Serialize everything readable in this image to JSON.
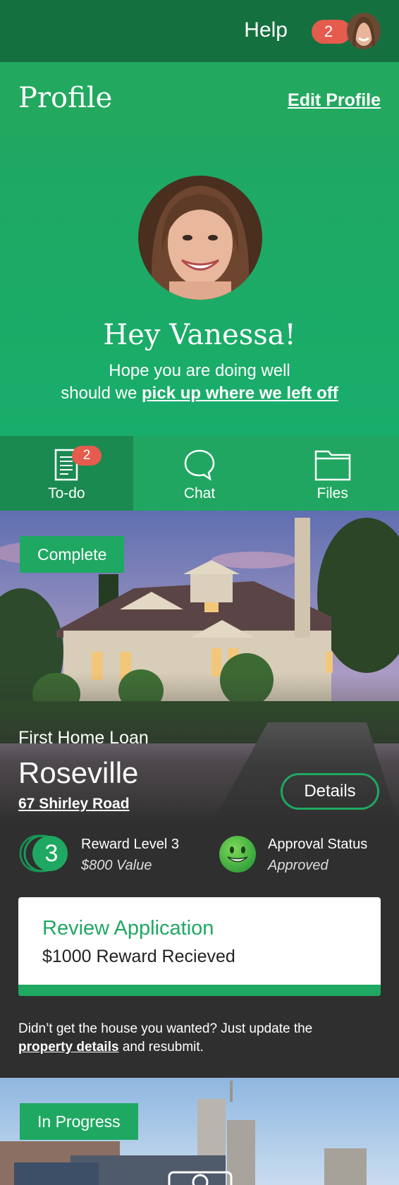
{
  "topbar": {
    "help_label": "Help",
    "notification_count": "2"
  },
  "profile": {
    "title": "Profile",
    "edit_label": "Edit Profile",
    "greeting": "Hey Vanessa!",
    "line1": "Hope you are doing well",
    "line2_prefix": "should we ",
    "line2_link": "pick up where we left off"
  },
  "tabs": [
    {
      "label": "To-do",
      "badge": "2",
      "icon": "document-icon"
    },
    {
      "label": "Chat",
      "icon": "chat-bubble-icon"
    },
    {
      "label": "Files",
      "icon": "folder-icon"
    }
  ],
  "application": {
    "status": "Complete",
    "loan_type": "First Home Loan",
    "suburb": "Roseville",
    "street": "67 Shirley Road",
    "details_label": "Details",
    "reward_level_number": "3",
    "reward_title": "Reward Level 3",
    "reward_value": "$800 Value",
    "approval_title": "Approval Status",
    "approval_value": "Approved",
    "review_title": "Review Application",
    "review_sub": "$1000 Reward Recieved",
    "review_progress": 1.0,
    "note_prefix": "Didn’t get the house you wanted? Just update the",
    "note_link": "property details",
    "note_suffix": " and resubmit."
  },
  "application2": {
    "status": "In Progress"
  },
  "colors": {
    "green": "#1fa862",
    "dark_green": "#14703f",
    "badge_red": "#e55b4d",
    "card_bg": "#2f2f2f"
  }
}
